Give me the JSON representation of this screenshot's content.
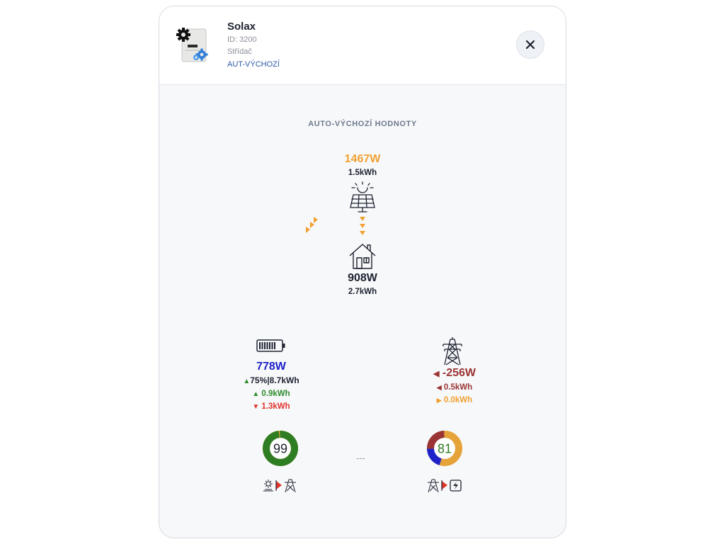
{
  "device": {
    "name": "Solax",
    "id": "ID: 3200",
    "type": "Střídač",
    "mode": "AUT-VÝCHOZÍ"
  },
  "section_title": "AUTO-VÝCHOZÍ HODNOTY",
  "solar": {
    "power": "1467W",
    "energy": "1.5kWh",
    "icon": "solar-panel-icon",
    "color": "#f0a030"
  },
  "home": {
    "power": "908W",
    "energy": "2.7kWh",
    "icon": "house-icon"
  },
  "battery": {
    "icon": "battery-icon",
    "power": "778W",
    "soc_energy": "75%|8.7kWh",
    "charged": "0.9kWh",
    "discharged": "1.3kWh",
    "power_color": "#1f22c8",
    "charged_color": "#2e8b2e",
    "discharged_color": "#e0342b"
  },
  "grid": {
    "icon": "power-tower-icon",
    "power": "-256W",
    "import": "0.5kWh",
    "export": "0.0kWh",
    "power_color": "#9b3434",
    "export_color": "#f0a030"
  },
  "gauges": {
    "self_sufficiency": {
      "value": "99",
      "percent": 99,
      "color": "#2e7d22",
      "label_icons": "sun-to-grid-icon"
    },
    "separator": "---",
    "self_consumption": {
      "value": "81",
      "segments": [
        {
          "percent": 55,
          "color": "#e6a33a"
        },
        {
          "percent": 20,
          "color": "#1f22c8"
        },
        {
          "percent": 25,
          "color": "#9b3434"
        }
      ],
      "label_icons": "grid-to-charger-icon"
    }
  }
}
